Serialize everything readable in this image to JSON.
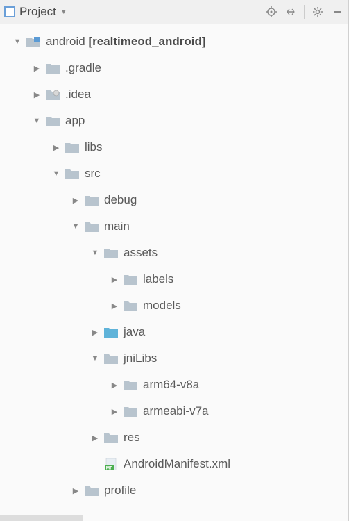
{
  "header": {
    "title": "Project"
  },
  "tree": {
    "android": {
      "label": "android",
      "bracket": "[realtimeod_android]"
    },
    "gradle": ".gradle",
    "idea": ".idea",
    "app": "app",
    "libs": "libs",
    "src": "src",
    "debug": "debug",
    "main": "main",
    "assets": "assets",
    "labels": "labels",
    "models": "models",
    "java": "java",
    "jniLibs": "jniLibs",
    "arm64": "arm64-v8a",
    "armeabi": "armeabi-v7a",
    "res": "res",
    "manifest": "AndroidManifest.xml",
    "profile": "profile"
  }
}
